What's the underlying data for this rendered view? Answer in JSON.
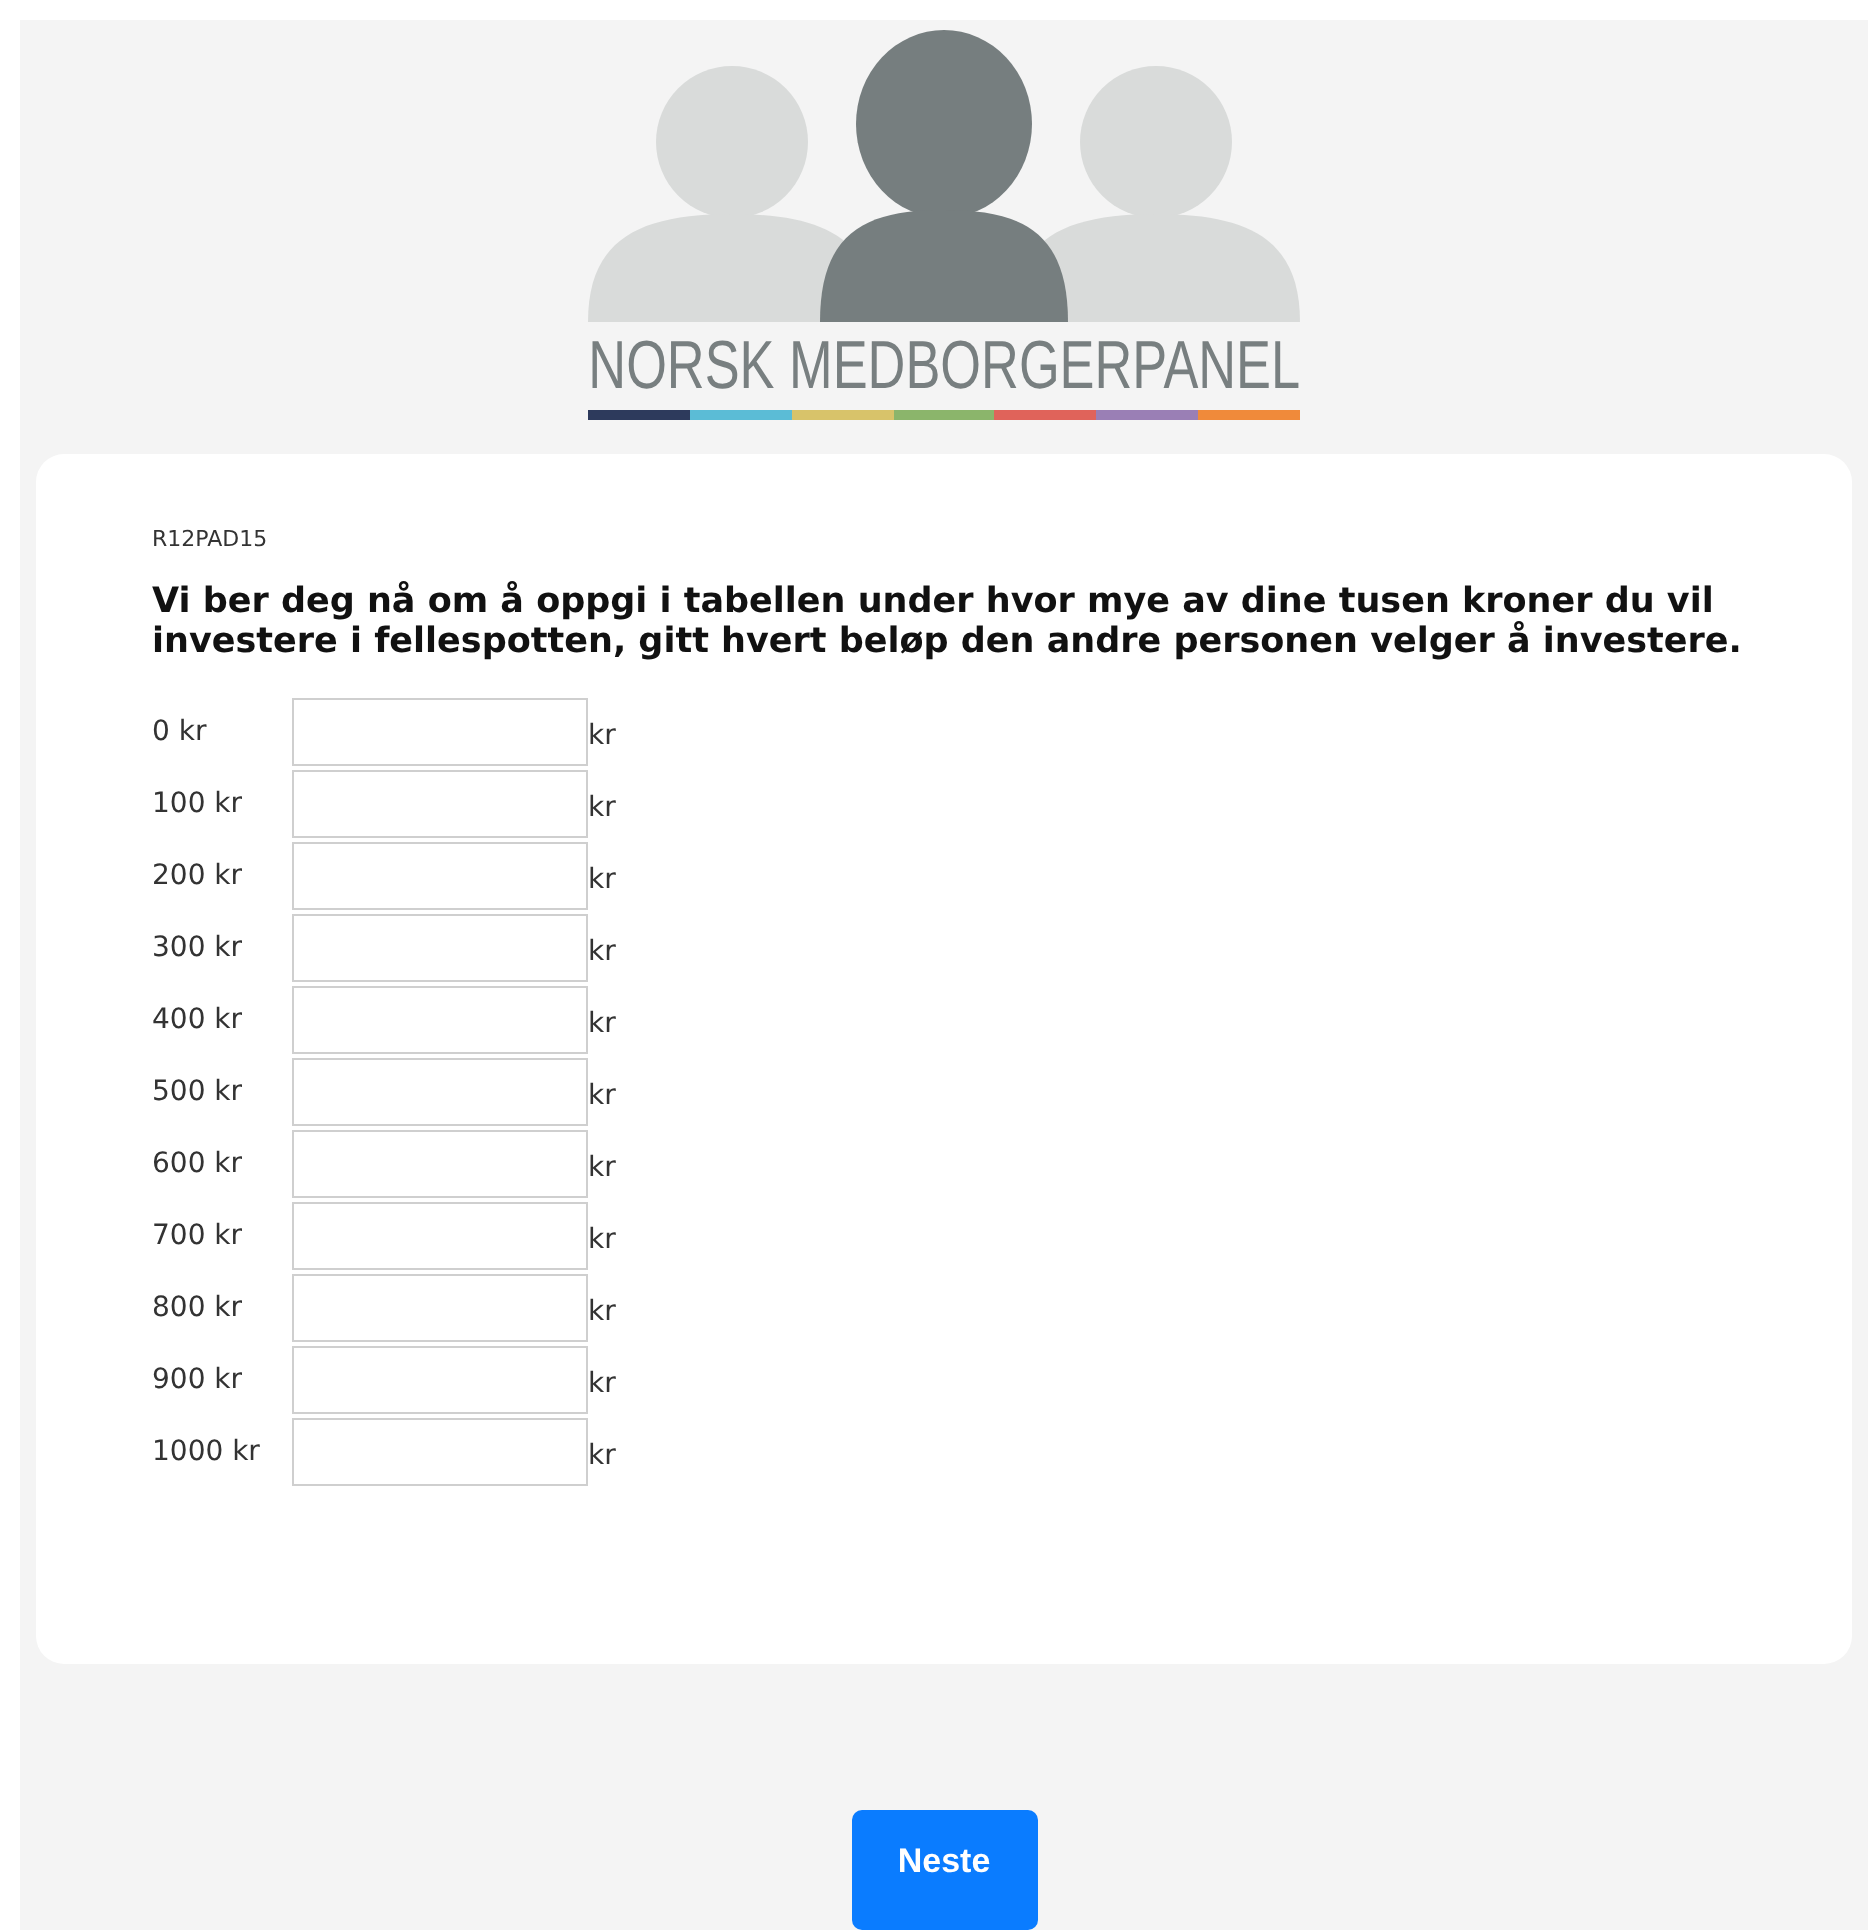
{
  "logo": {
    "text": "NORSK MEDBORGERPANEL"
  },
  "question": {
    "code": "R12PAD15",
    "text": "Vi ber deg nå om å oppgi i tabellen under hvor mye av dine tusen kroner du vil investere i fellespotten, gitt hvert beløp den andre personen velger å investere."
  },
  "rows": [
    {
      "label": "0 kr",
      "unit": "kr"
    },
    {
      "label": "100 kr",
      "unit": "kr"
    },
    {
      "label": "200 kr",
      "unit": "kr"
    },
    {
      "label": "300 kr",
      "unit": "kr"
    },
    {
      "label": "400 kr",
      "unit": "kr"
    },
    {
      "label": "500 kr",
      "unit": "kr"
    },
    {
      "label": "600 kr",
      "unit": "kr"
    },
    {
      "label": "700 kr",
      "unit": "kr"
    },
    {
      "label": "800 kr",
      "unit": "kr"
    },
    {
      "label": "900 kr",
      "unit": "kr"
    },
    {
      "label": "1000 kr",
      "unit": "kr"
    }
  ],
  "next_button": {
    "label": "Neste"
  }
}
